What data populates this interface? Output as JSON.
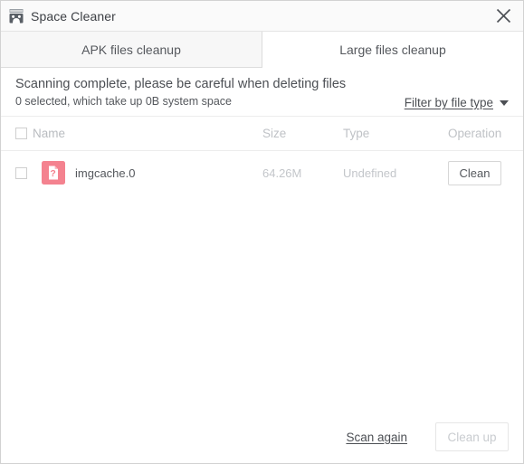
{
  "window": {
    "title": "Space Cleaner",
    "app_icon": "space-cleaner-icon",
    "close_icon": "close-icon"
  },
  "tabs": [
    {
      "label": "APK files cleanup",
      "active": false
    },
    {
      "label": "Large files cleanup",
      "active": true
    }
  ],
  "status": {
    "line1": "Scanning complete, please be careful when deleting files",
    "line2": "0 selected, which take up 0B system space",
    "filter_label": "Filter by file type",
    "filter_caret_icon": "chevron-down-icon"
  },
  "table": {
    "columns": [
      "Name",
      "Size",
      "Type",
      "Operation"
    ],
    "rows": [
      {
        "checked": false,
        "icon": "unknown-file-icon",
        "name": "imgcache.0",
        "size": "64.26M",
        "type": "Undefined",
        "operation": "Clean"
      }
    ]
  },
  "footer": {
    "scan_again": "Scan again",
    "clean_up": "Clean up"
  },
  "colors": {
    "file_icon": "#f4828f",
    "title_text": "#3d4045",
    "muted_text": "#bfc2c6",
    "border": "#e4e4e4",
    "tab_inactive_bg": "#f7f7f7"
  }
}
